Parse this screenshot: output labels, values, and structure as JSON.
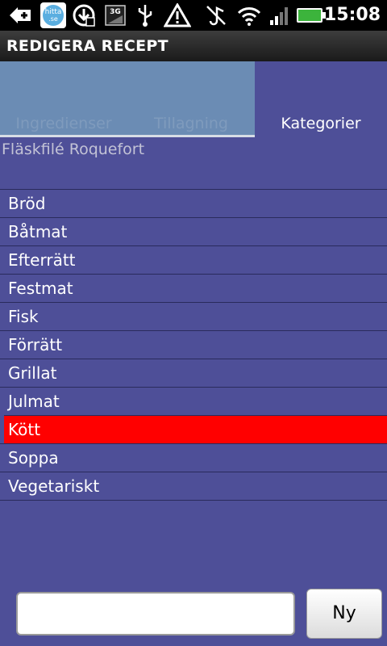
{
  "status_bar": {
    "time": "15:08",
    "app_badge": "hitta.se",
    "network": "3G",
    "battery_color": "#3cb43c",
    "icons": [
      "add-icon",
      "hitta-app-icon",
      "download-icon",
      "3g-icon",
      "usb-icon",
      "warning-icon",
      "vibrate-muted-icon",
      "wifi-icon",
      "signal-icon",
      "battery-icon"
    ]
  },
  "title_bar": {
    "title": "REDIGERA RECEPT"
  },
  "tabs": [
    {
      "label": "Ingredienser",
      "active": false
    },
    {
      "label": "Tillagning",
      "active": false
    },
    {
      "label": "Kategorier",
      "active": true
    }
  ],
  "recipe": {
    "name": "Fläskfilé Roquefort"
  },
  "categories": [
    "Bröd",
    "Båtmat",
    "Efterrätt",
    "Festmat",
    "Fisk",
    "Förrätt",
    "Grillat",
    "Julmat",
    "Kött",
    "Soppa",
    "Vegetariskt"
  ],
  "selected_category": "Kött",
  "new_category": {
    "value": "",
    "button_label": "Ny"
  },
  "colors": {
    "background": "#4e4f98",
    "selected": "#ff0000",
    "inactive_tab": "#6b8cb4"
  }
}
